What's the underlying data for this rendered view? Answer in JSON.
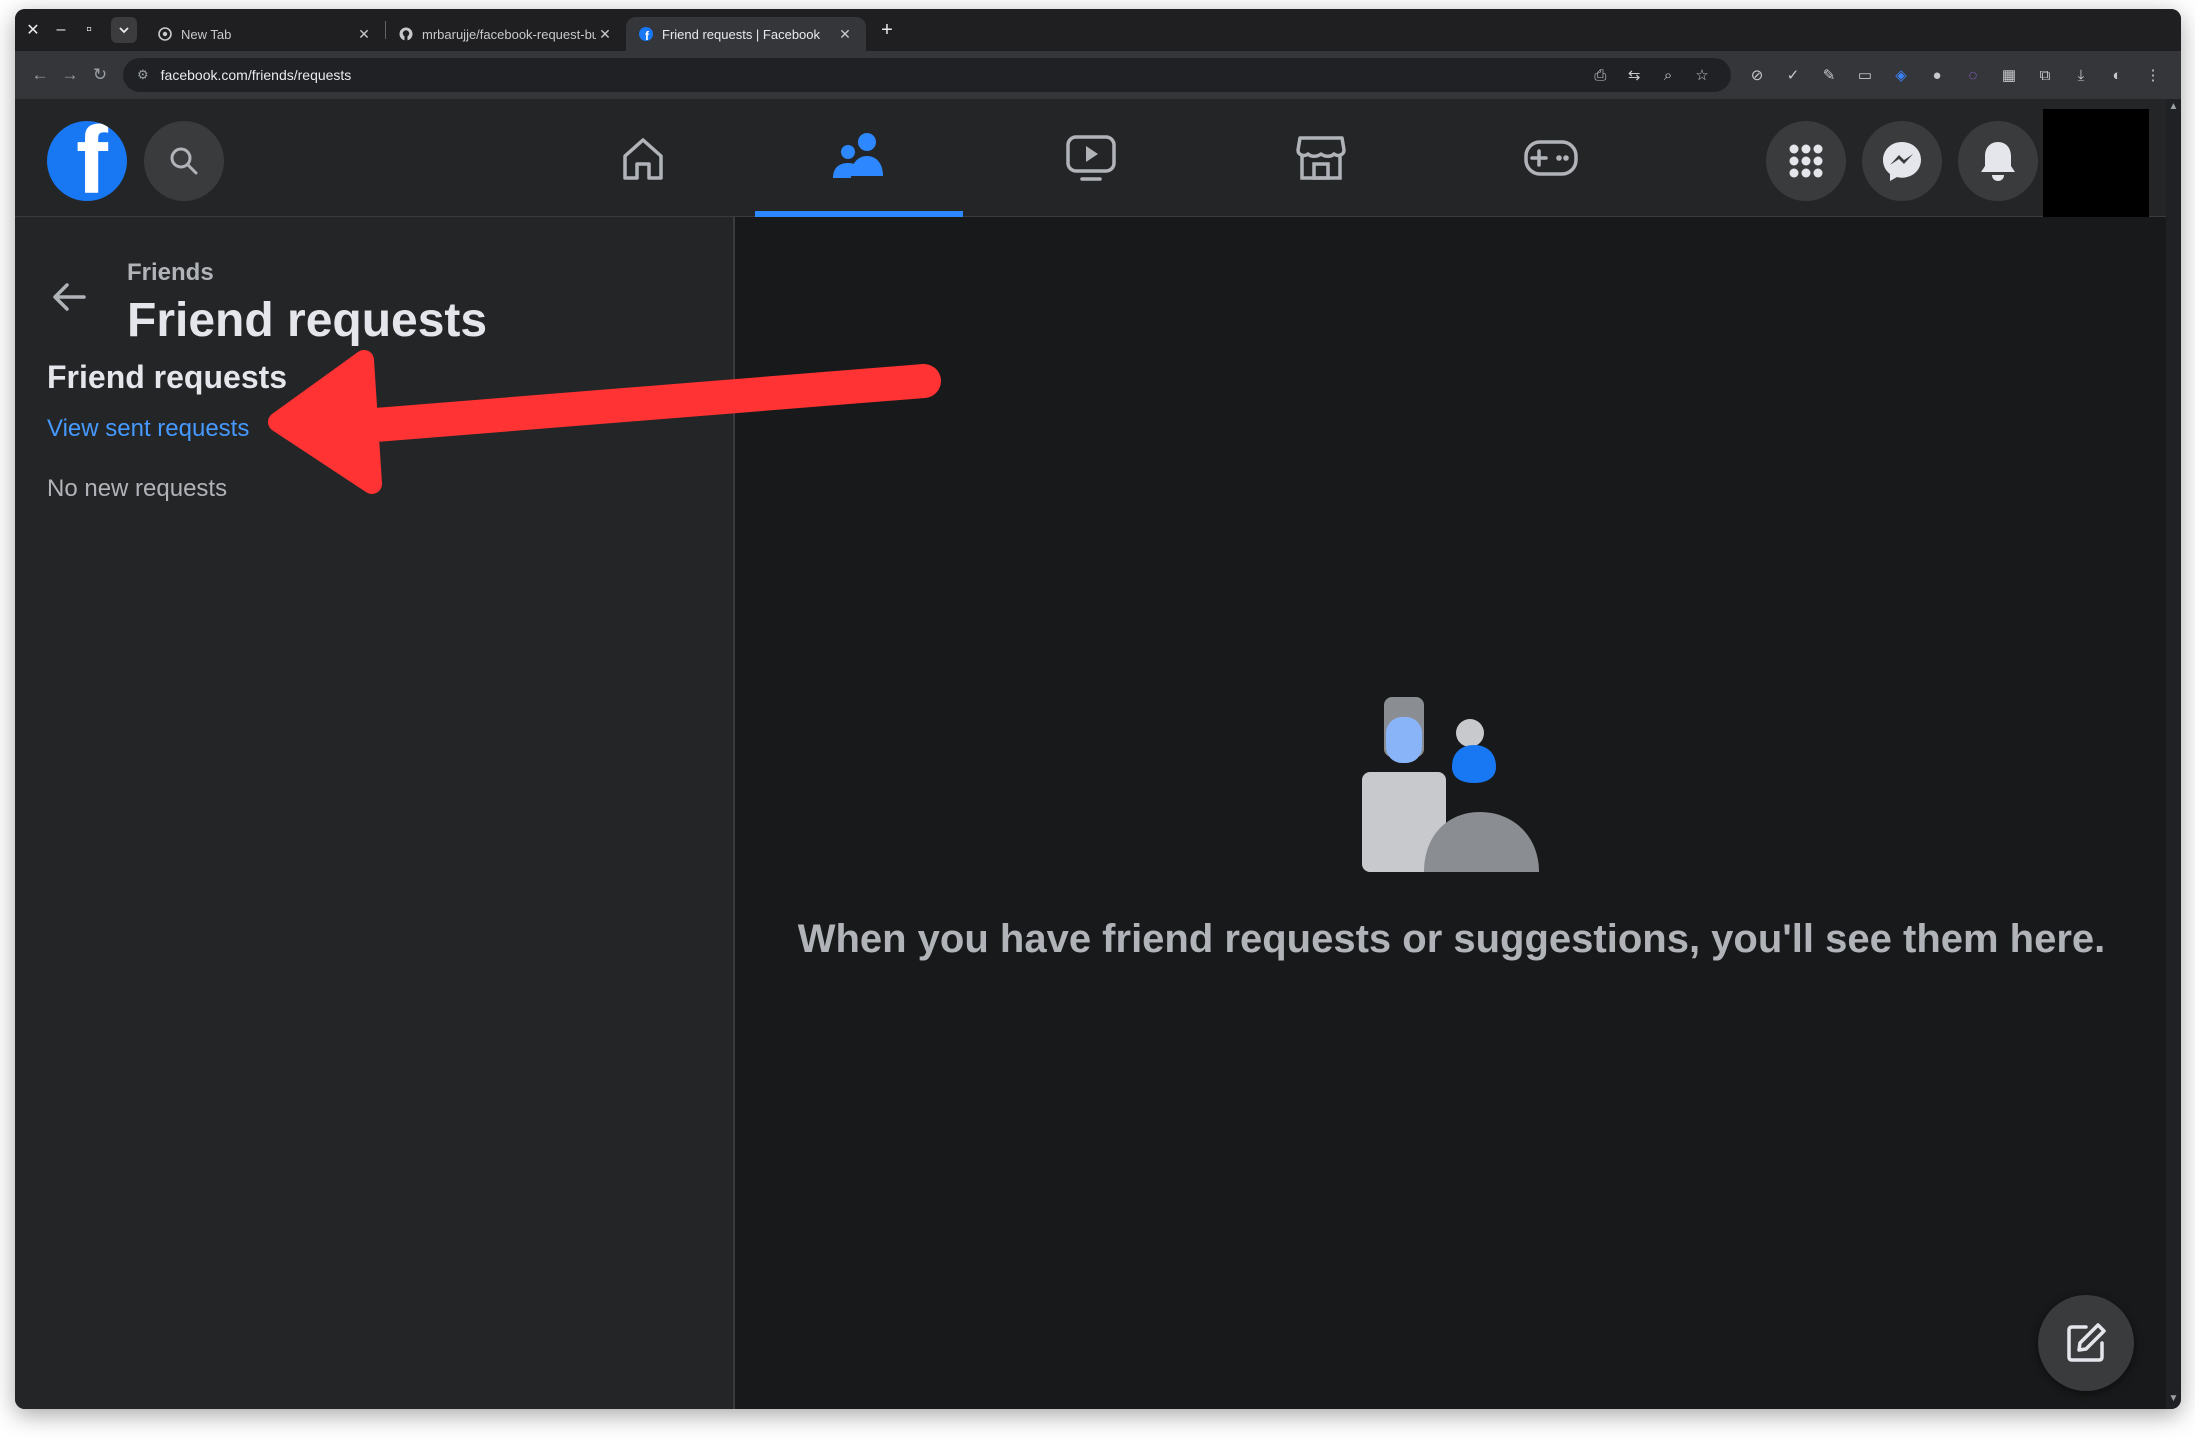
{
  "browser": {
    "tabs": [
      {
        "title": "New Tab",
        "favicon": "chrome-icon"
      },
      {
        "title": "mrbarujje/facebook-request-bulk-cancel",
        "favicon": "github-icon"
      },
      {
        "title": "Friend requests | Facebook",
        "favicon": "facebook-icon",
        "active": true
      }
    ],
    "url": "facebook.com/friends/requests"
  },
  "header": {
    "logo_letter": "f",
    "nav": [
      {
        "name": "home",
        "icon": "home-icon",
        "active": false
      },
      {
        "name": "friends",
        "icon": "friends-icon",
        "active": true
      },
      {
        "name": "watch",
        "icon": "video-icon",
        "active": false
      },
      {
        "name": "marketplace",
        "icon": "store-icon",
        "active": false
      },
      {
        "name": "gaming",
        "icon": "gamepad-icon",
        "active": false
      }
    ]
  },
  "sidebar": {
    "breadcrumb": "Friends",
    "title": "Friend requests",
    "section_title": "Friend requests",
    "sent_link": "View sent requests",
    "empty_text": "No new requests"
  },
  "main": {
    "empty_message": "When you have friend requests or suggestions, you'll see them here."
  },
  "colors": {
    "accent": "#1877f2",
    "link": "#4599ff",
    "annotation": "#ff3333"
  }
}
